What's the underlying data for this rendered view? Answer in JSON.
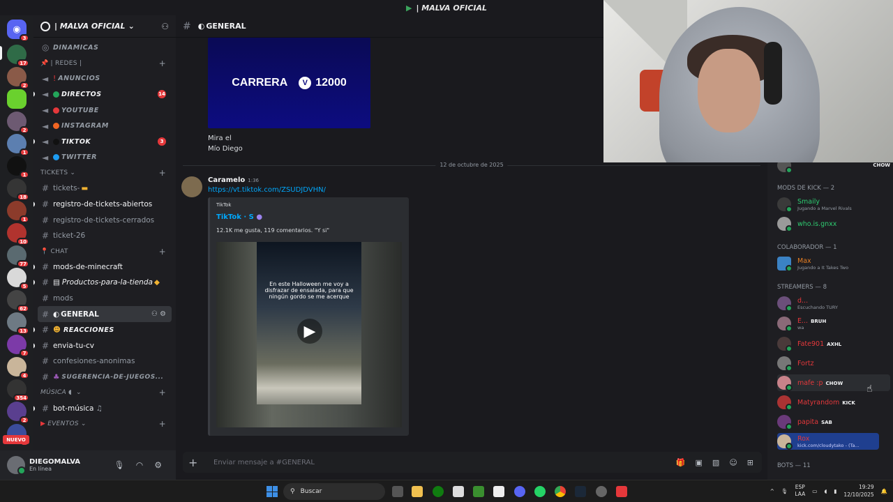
{
  "window": {
    "title": "| MALVA OFICIAL"
  },
  "guild": {
    "name": "| MALVA OFICIAL"
  },
  "rail": {
    "nuevo": "NUEVO",
    "badges": [
      "3",
      "17",
      "2",
      "2",
      "1",
      "1",
      "18",
      "1",
      "10",
      "77",
      "5",
      "62",
      "13",
      "7",
      "4",
      "354",
      "2",
      "9"
    ]
  },
  "channels": {
    "dinamicas": "DINAMICAS",
    "cat_redes": "| REDES |",
    "anuncios": "ANUNCIOS",
    "directos": "DIRECTOS",
    "directos_count": "14",
    "youtube": "YOUTUBE",
    "instagram": "INSTAGRAM",
    "tiktok": "TIKTOK",
    "tiktok_count": "3",
    "twitter": "TWITTER",
    "cat_tickets": "TICKETS",
    "tickets": "tickets-",
    "registro_abiertos": "registro-de-tickets-abiertos",
    "registro_cerrados": "registro-de-tickets-cerrados",
    "ticket26": "ticket-26",
    "cat_chat": "CHAT",
    "mods_minecraft": "mods-de-minecraft",
    "productos": "Productos-para-la-tienda",
    "mods": "mods",
    "general": "GENERAL",
    "reacciones": "REACCIONES",
    "envia_cv": "envia-tu-cv",
    "confesiones": "confesiones-anonimas",
    "sugerencia": "SUGERENCIA-DE-JUEGOS...",
    "cat_musica": "MÚSICA",
    "bot_musica": "bot-música",
    "cat_eventos": "EVENTOS"
  },
  "user": {
    "name": "DIEGOMALVA",
    "status": "En línea"
  },
  "chat": {
    "header": "GENERAL",
    "banner_left": "CARRERA",
    "banner_value": "12000",
    "prev_line1": "Mira el",
    "prev_line2": "Mío Diego",
    "date_divider": "12 de octubre de 2025",
    "author": "Caramelo",
    "time": "1:36",
    "link": "https://vt.tiktok.com/ZSUDJDVHN/",
    "embed_provider": "TikTok",
    "embed_title": "TikTok · S",
    "embed_desc": "12.1K me gusta, 119 comentarios. \"Y si\"",
    "video_caption": "En este Halloween me voy a disfrazar de ensalada, para que ningún gordo se me acerque",
    "composer_placeholder": "Enviar mensaje a #GENERAL"
  },
  "members": {
    "top_tag": "CHOW",
    "group_mods": "MODS DE KICK — 2",
    "smaily": "Smaily",
    "smaily_sub": "Jugando a Marvel Rivals",
    "whoisgnxx": "who.is.gnxx",
    "group_colab": "COLABORADOR — 1",
    "max": "Max",
    "max_sub": "Jugando a It Takes Two",
    "group_streamers": "STREAMERS — 8",
    "s1_sub": "Escuchando TURY",
    "s2_tag": "BRUH",
    "s2_sub": "wa",
    "fate": "Fate901",
    "fate_tag": "AXHL",
    "fortz": "Fortz",
    "mafe": "mafe :p",
    "mafe_tag": "CHOW",
    "matyrandom": "Matyrandom",
    "maty_tag": "KICK",
    "papita": "papita",
    "papita_tag": "SAB",
    "rox": "Rox",
    "rox_sub": "kick.com/cloudytako - (Ta...",
    "group_bots": "BOTS — 11"
  },
  "taskbar": {
    "search": "Buscar",
    "lang1": "ESP",
    "lang2": "LAA",
    "time": "19:29",
    "date": "12/10/2025"
  },
  "colors": {
    "accent": "#5865f2",
    "link": "#00a8fc",
    "badge": "#e5383b",
    "online": "#23a55a"
  }
}
